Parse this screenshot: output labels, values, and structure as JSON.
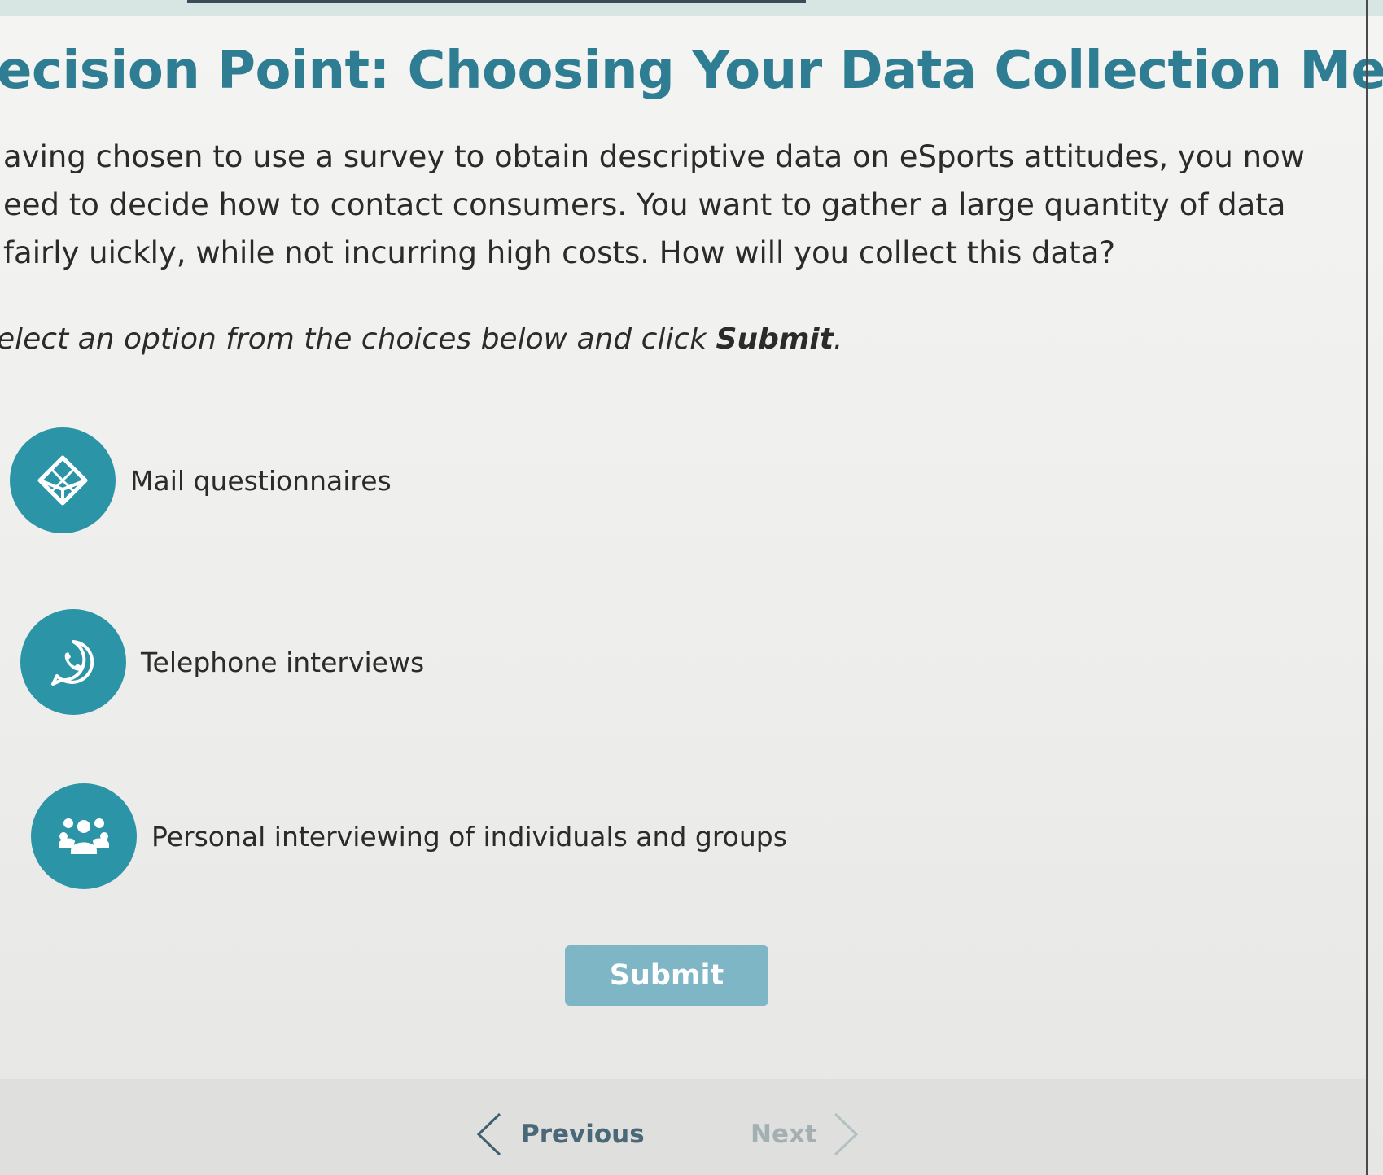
{
  "page": {
    "title": "ecision Point: Choosing Your Data Collection Method",
    "intro": "aving chosen to use a survey to obtain descriptive data on eSports attitudes, you now eed to decide how to contact consumers. You want to gather a large quantity of data fairly uickly, while not incurring high costs. How will you collect this data?",
    "instruction_prefix": "elect an option from the choices below and click ",
    "instruction_bold": "Submit",
    "instruction_suffix": "."
  },
  "options": [
    {
      "label": "Mail questionnaires",
      "icon": "box-icon"
    },
    {
      "label": "Telephone interviews",
      "icon": "phone-icon"
    },
    {
      "label": "Personal interviewing of individuals and groups",
      "icon": "group-icon"
    }
  ],
  "actions": {
    "submit_label": "Submit"
  },
  "navigation": {
    "previous_label": "Previous",
    "next_label": "Next"
  },
  "colors": {
    "title": "#2f7d92",
    "option_circle": "#2c94a7",
    "submit_button": "#7fb6c6",
    "previous_text": "#4a6878",
    "next_text_disabled": "#a3afb3"
  }
}
